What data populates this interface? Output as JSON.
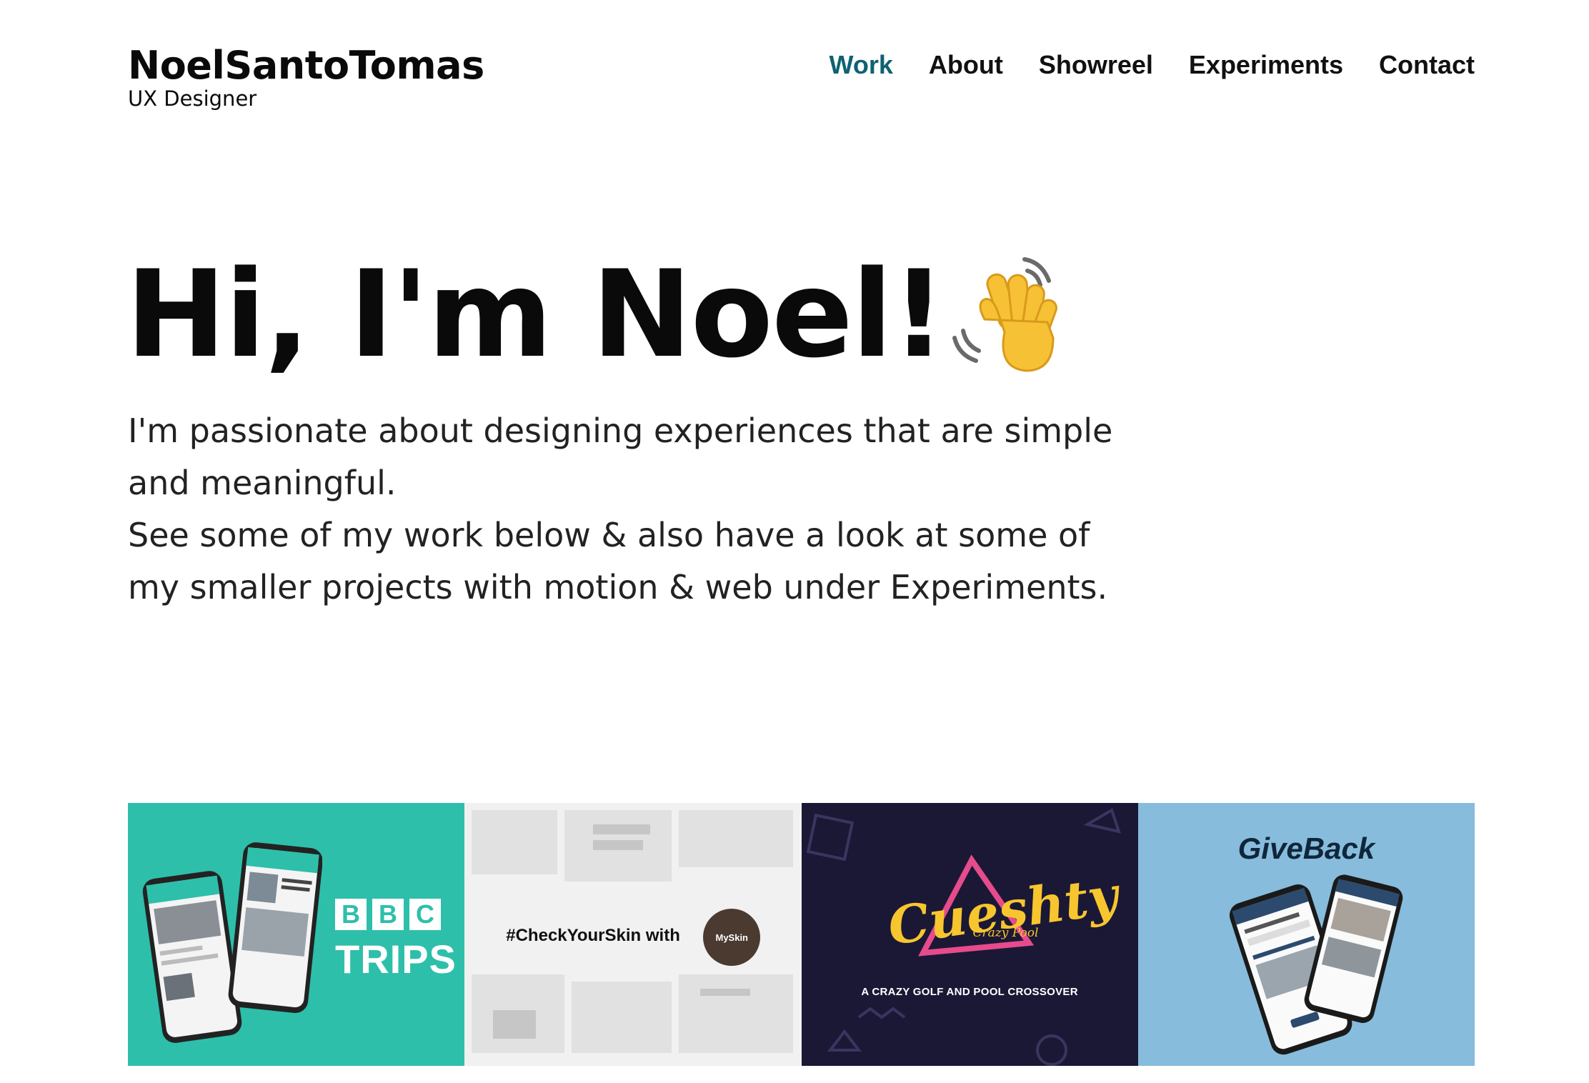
{
  "header": {
    "brand_name": "NoelSantoTomas",
    "brand_subtitle": "UX Designer",
    "nav": [
      {
        "label": "Work",
        "active": true
      },
      {
        "label": "About",
        "active": false
      },
      {
        "label": "Showreel",
        "active": false
      },
      {
        "label": "Experiments",
        "active": false
      },
      {
        "label": "Contact",
        "active": false
      }
    ]
  },
  "hero": {
    "title": "Hi, I'm Noel!",
    "emoji_icon": "waving-hand-icon",
    "intro_line1": "I'm passionate about designing experiences that are simple and meaningful.",
    "intro_line2": "See some of my work below & also have a look at some of my smaller projects with motion & web under Experiments."
  },
  "projects": [
    {
      "name": "bbc-trips",
      "logo_text": [
        "B",
        "B",
        "C"
      ],
      "title": "TRIPS",
      "bg": "#2ebfab"
    },
    {
      "name": "myskin",
      "tagline": "#CheckYourSkin with",
      "logo": "MySkin",
      "bg": "#f1f1f1"
    },
    {
      "name": "cueshty",
      "title": "Cueshty",
      "subtitle": "Crazy Pool",
      "tagline": "A CRAZY GOLF AND POOL CROSSOVER",
      "bg": "#1b1836"
    },
    {
      "name": "giveback",
      "title": "GiveBack",
      "bg": "#87bcdc"
    }
  ],
  "colors": {
    "accent": "#0e6272",
    "text": "#0a0a0a"
  }
}
